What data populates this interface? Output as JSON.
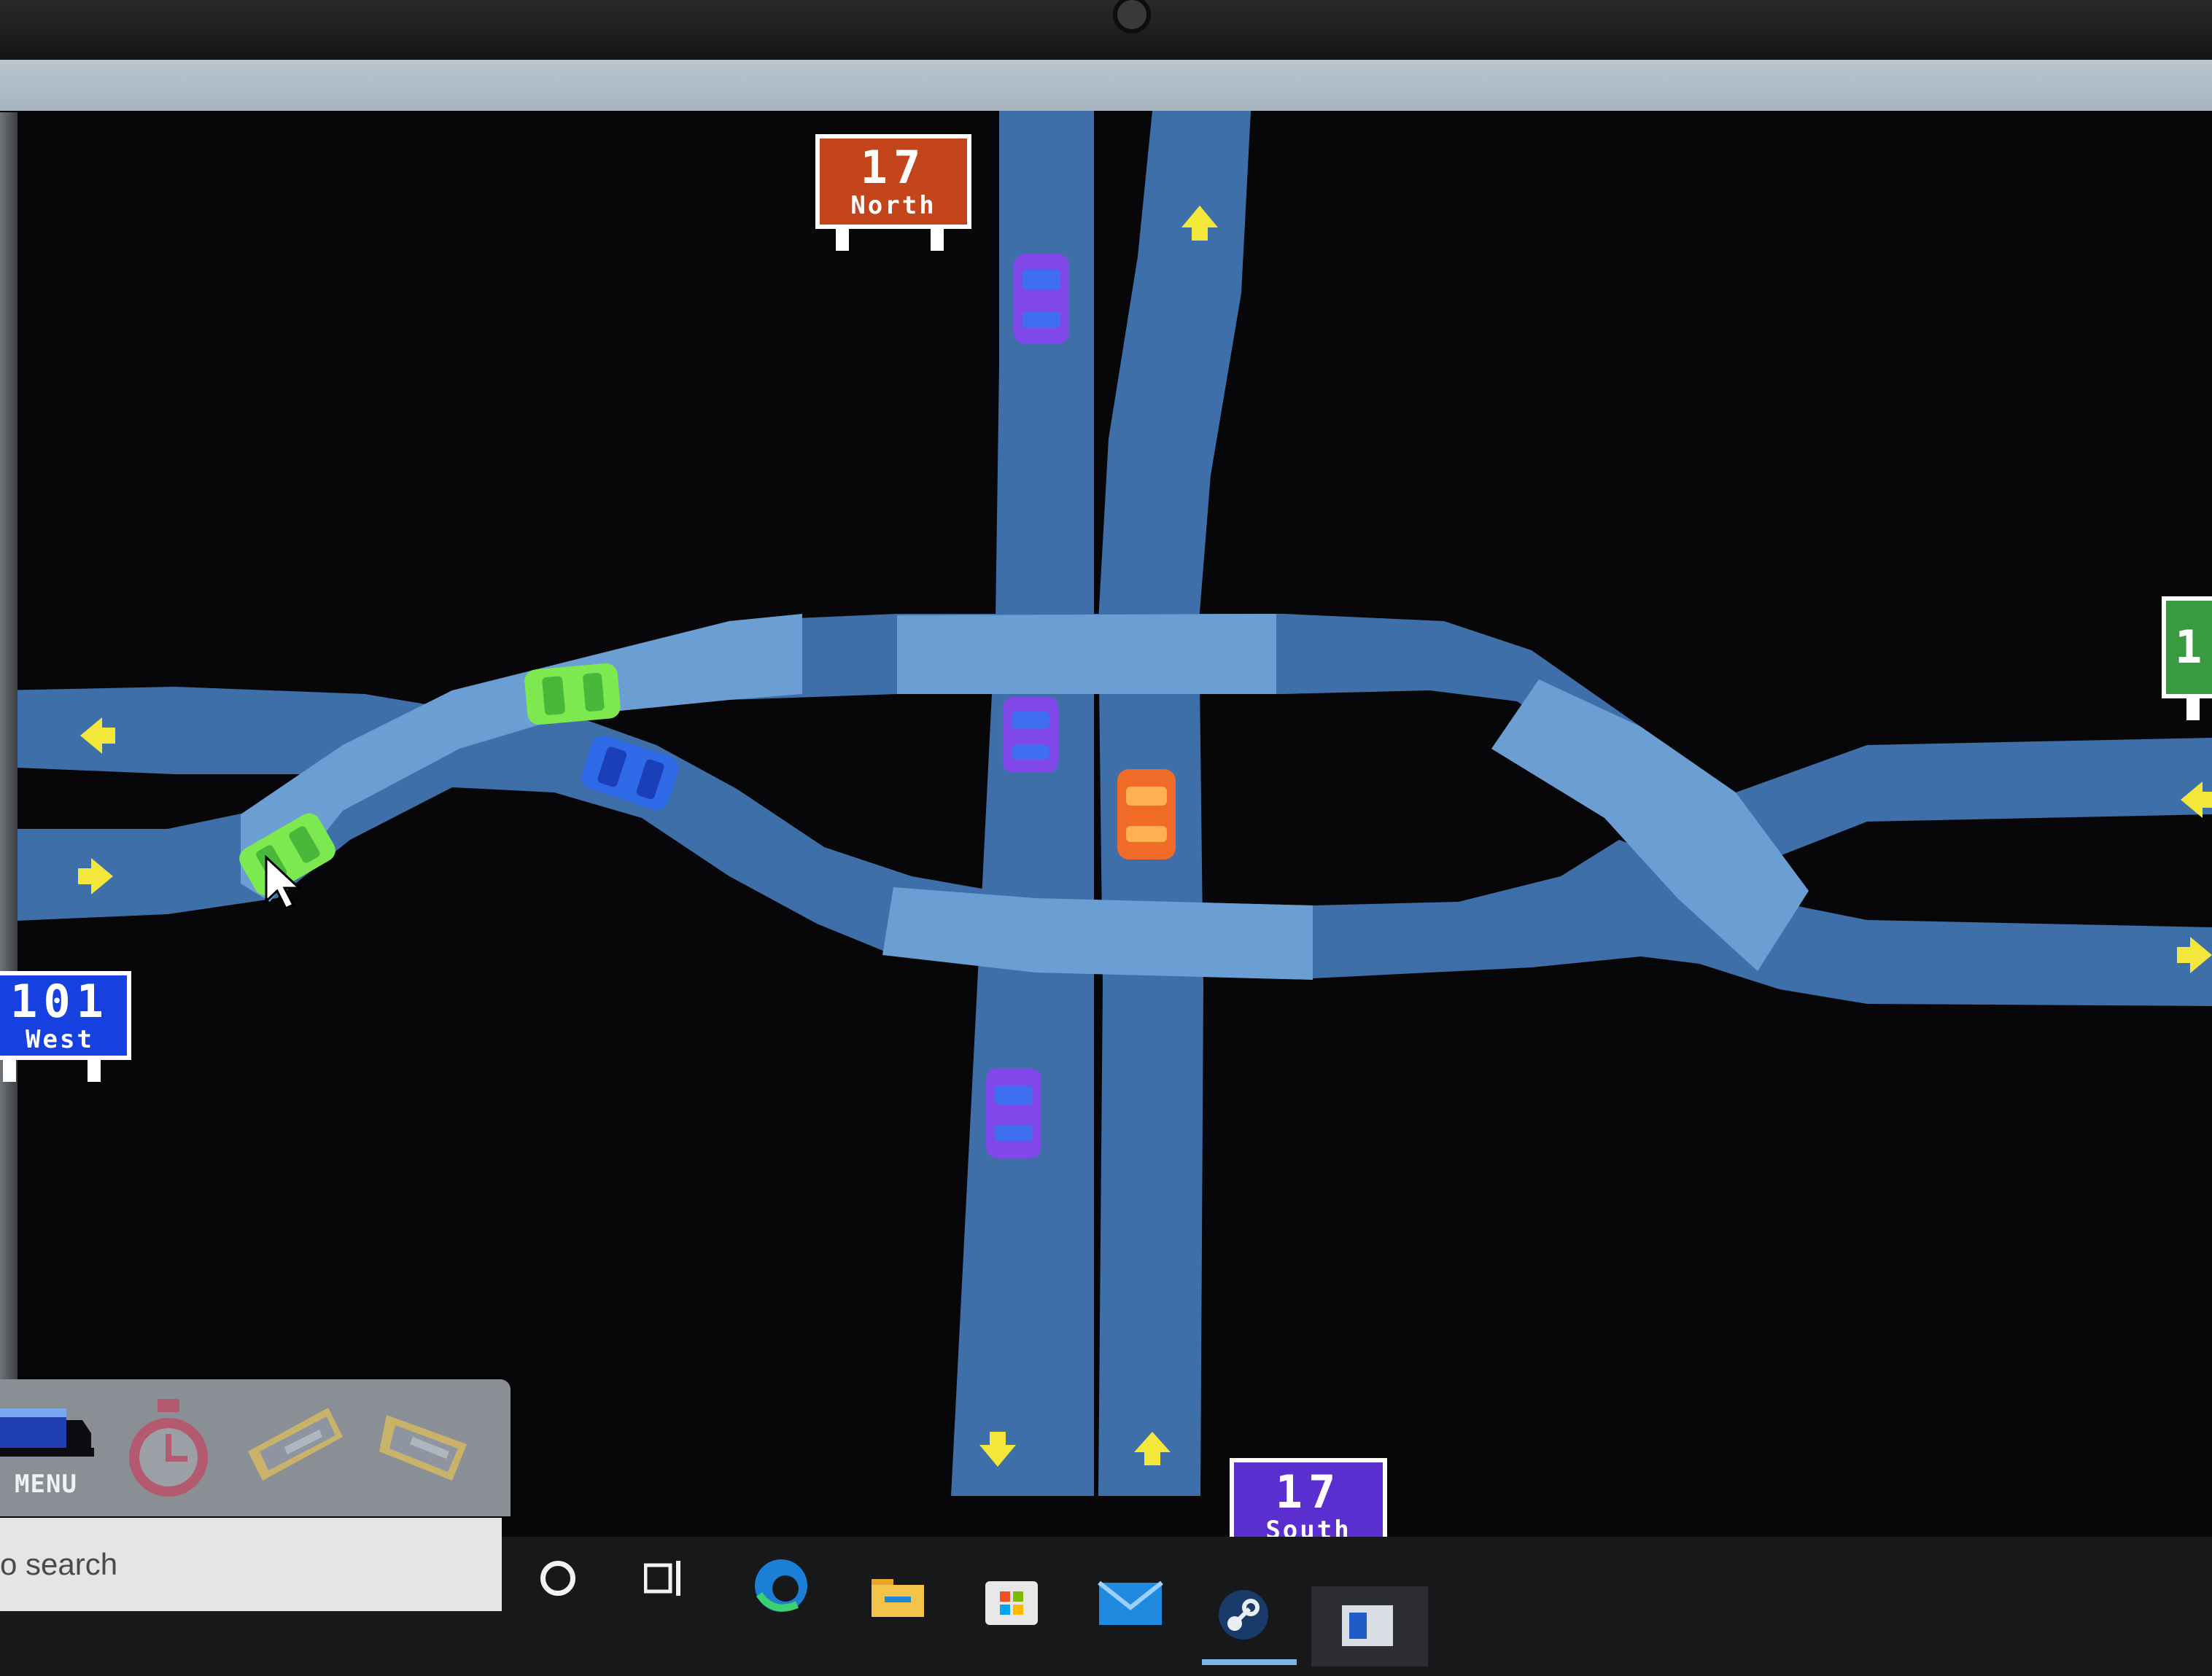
{
  "signs": {
    "north": {
      "route": "17",
      "direction": "North",
      "color": "#c4441b"
    },
    "west": {
      "route": "101",
      "direction": "West",
      "color": "#1640e0"
    },
    "south": {
      "route": "17",
      "direction": "South",
      "color": "#5b2ed0"
    },
    "east_partial": {
      "route": "1",
      "color": "#3a9a42"
    }
  },
  "hud": {
    "menu_label": "MENU",
    "buttons": [
      "menu-truck",
      "timer",
      "road-tool",
      "road-tool-alt"
    ]
  },
  "taskbar": {
    "search_placeholder": "o search",
    "icons": [
      "cortana-icon",
      "task-view-icon",
      "edge-icon",
      "file-explorer-icon",
      "store-icon",
      "mail-icon",
      "steam-icon",
      "game-app-icon"
    ]
  },
  "colors": {
    "road_dark": "#3f6fa8",
    "road_light": "#6b9fd4",
    "arrow": "#f2e73a",
    "background": "#070709"
  },
  "cars": [
    "purple",
    "purple",
    "purple",
    "orange",
    "green",
    "green",
    "blue"
  ]
}
